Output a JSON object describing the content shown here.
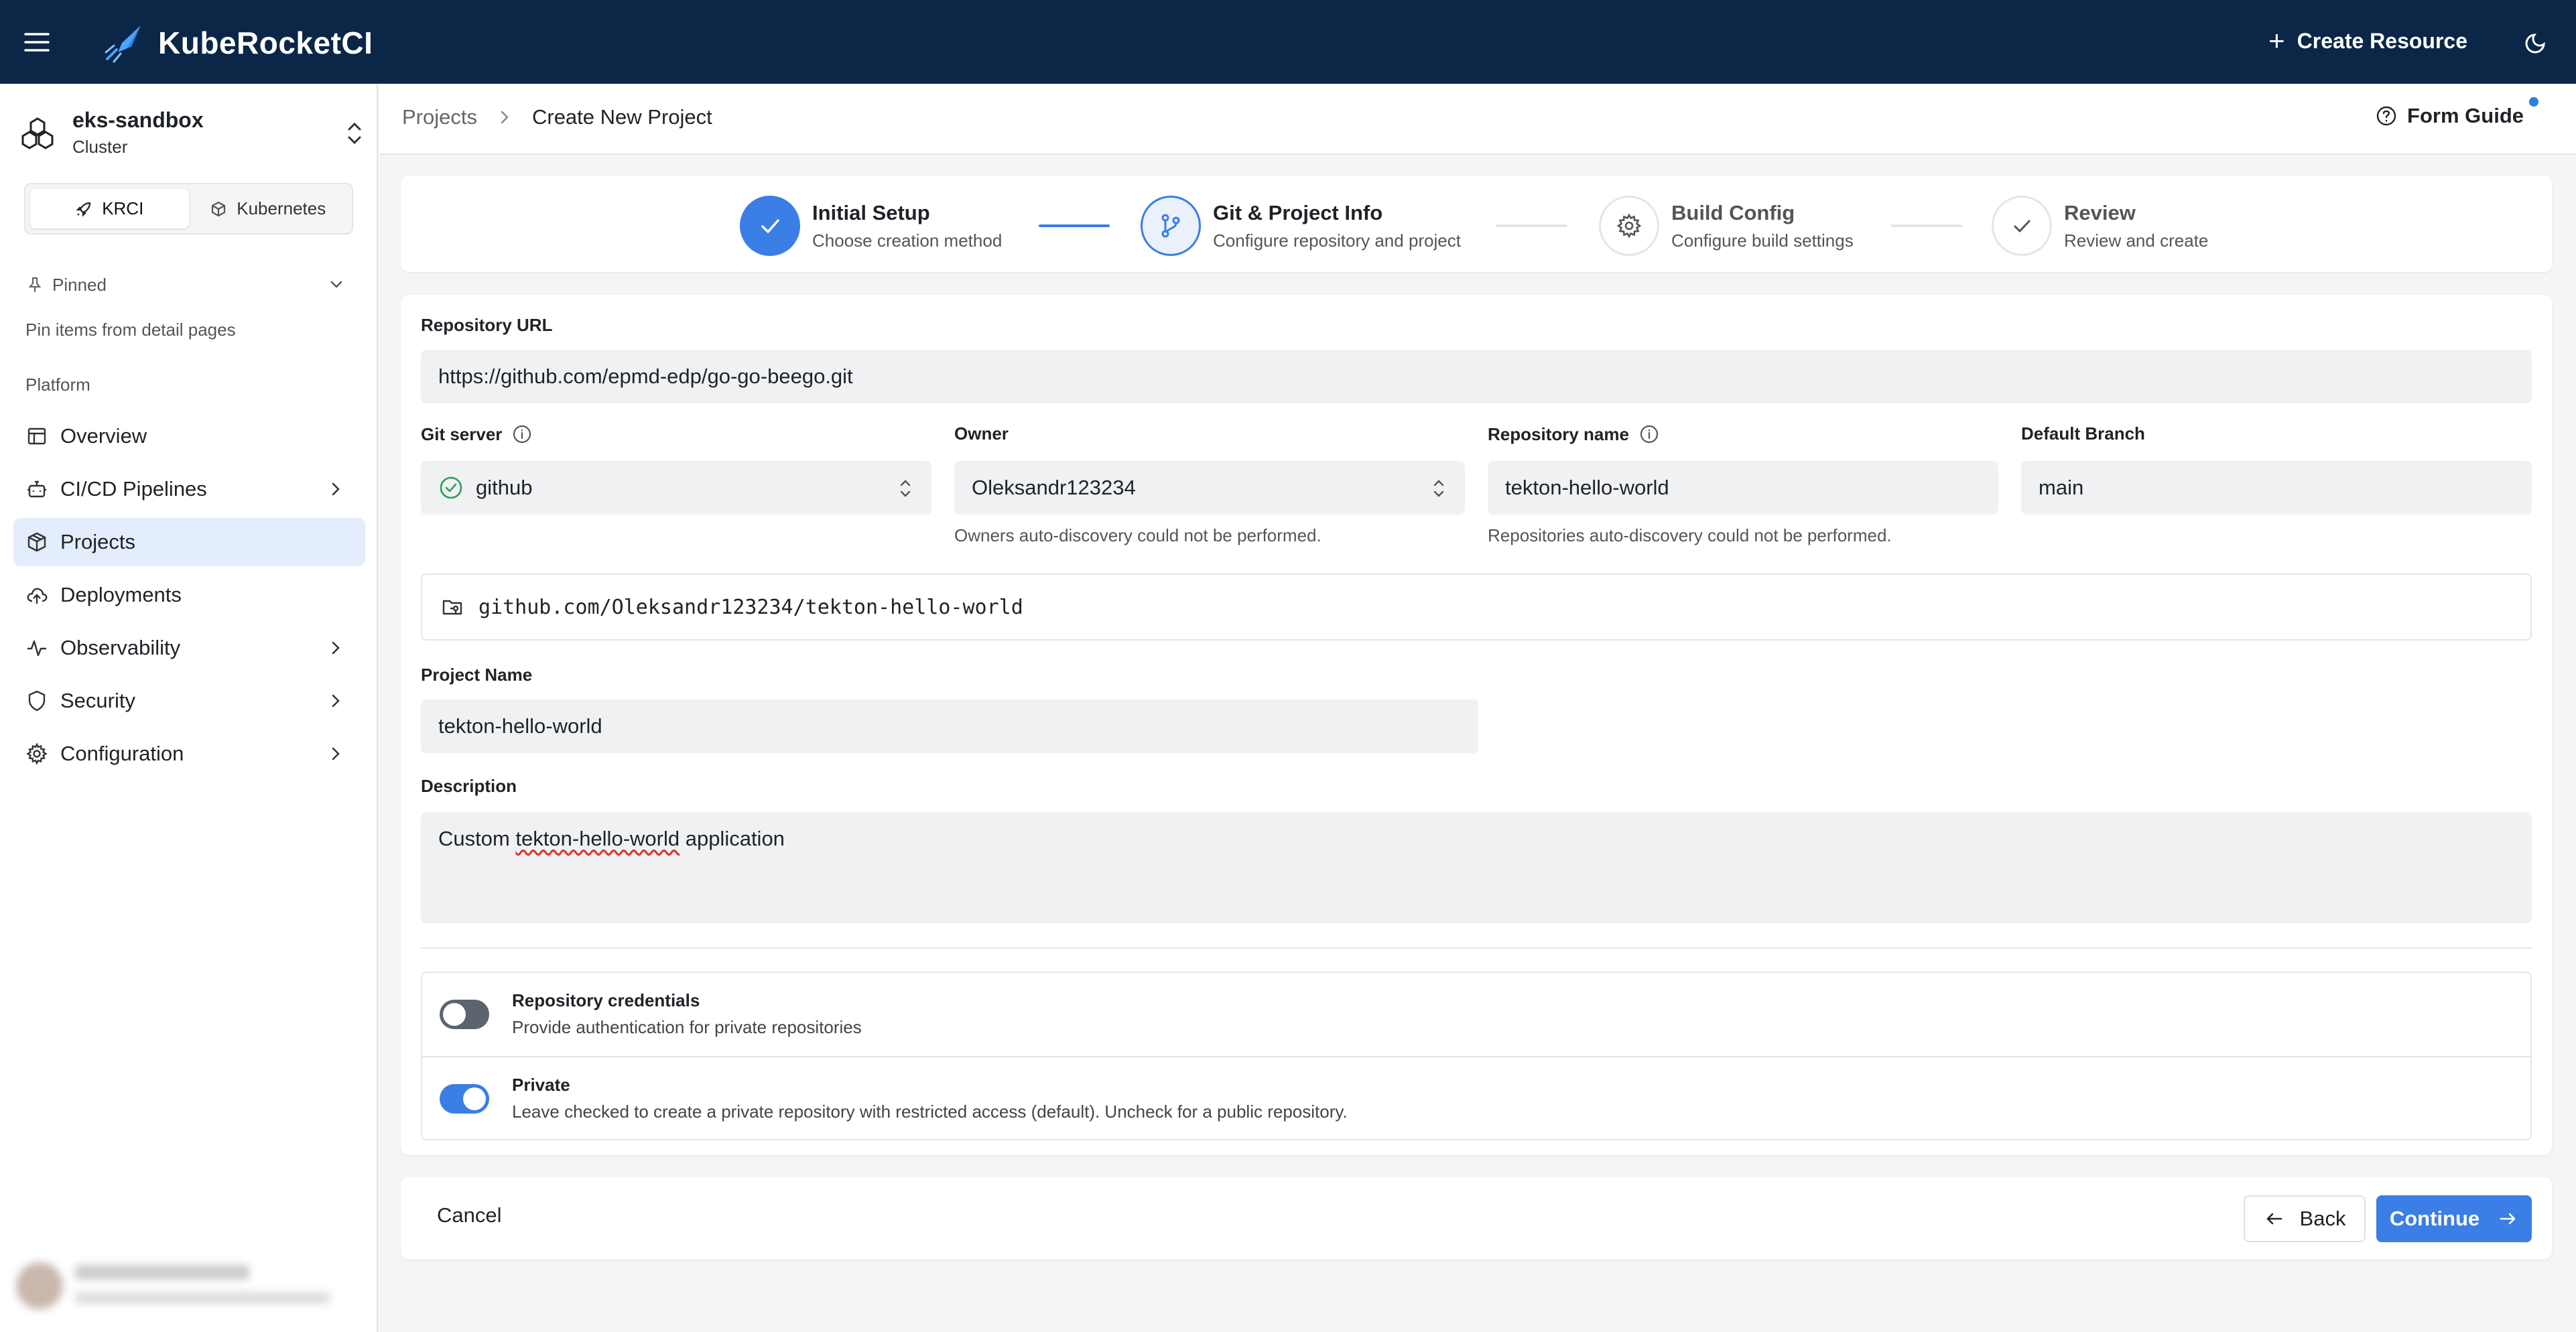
{
  "app": {
    "name": "KubeRocketCI",
    "create_resource_label": "Create Resource"
  },
  "cluster": {
    "name": "eks-sandbox",
    "type": "Cluster"
  },
  "view_switch": {
    "items": [
      {
        "label": "KRCI",
        "active": true
      },
      {
        "label": "Kubernetes",
        "active": false
      }
    ]
  },
  "pinned": {
    "label": "Pinned",
    "hint": "Pin items from detail pages"
  },
  "sidebar": {
    "section_label": "Platform",
    "items": [
      {
        "label": "Overview",
        "icon": "table-icon",
        "expandable": false,
        "active": false
      },
      {
        "label": "CI/CD Pipelines",
        "icon": "bot-icon",
        "expandable": true,
        "active": false
      },
      {
        "label": "Projects",
        "icon": "box-icon",
        "expandable": false,
        "active": true
      },
      {
        "label": "Deployments",
        "icon": "cloud-upload-icon",
        "expandable": false,
        "active": false
      },
      {
        "label": "Observability",
        "icon": "activity-icon",
        "expandable": true,
        "active": false
      },
      {
        "label": "Security",
        "icon": "shield-icon",
        "expandable": true,
        "active": false
      },
      {
        "label": "Configuration",
        "icon": "gear-icon",
        "expandable": true,
        "active": false
      }
    ]
  },
  "breadcrumb": {
    "parent": "Projects",
    "current": "Create New Project"
  },
  "form_guide_label": "Form Guide",
  "stepper": {
    "steps": [
      {
        "title": "Initial Setup",
        "subtitle": "Choose creation method",
        "state": "done"
      },
      {
        "title": "Git & Project Info",
        "subtitle": "Configure repository and project",
        "state": "current"
      },
      {
        "title": "Build Config",
        "subtitle": "Configure build settings",
        "state": "pending"
      },
      {
        "title": "Review",
        "subtitle": "Review and create",
        "state": "pending"
      }
    ]
  },
  "form": {
    "repository_url": {
      "label": "Repository URL",
      "value": "https://github.com/epmd-edp/go-go-beego.git"
    },
    "git_server": {
      "label": "Git server",
      "value": "github"
    },
    "owner": {
      "label": "Owner",
      "value": "Oleksandr123234",
      "hint": "Owners auto-discovery could not be performed."
    },
    "repository_name": {
      "label": "Repository name",
      "value": "tekton-hello-world",
      "hint": "Repositories auto-discovery could not be performed."
    },
    "default_branch": {
      "label": "Default Branch",
      "value": "main"
    },
    "repo_path": "github.com/Oleksandr123234/tekton-hello-world",
    "project_name": {
      "label": "Project Name",
      "value": "tekton-hello-world"
    },
    "description": {
      "label": "Description",
      "value_prefix": "Custom ",
      "value_misspelled": "tekton-hello-world",
      "value_suffix": " application"
    },
    "repository_credentials": {
      "title": "Repository credentials",
      "description": "Provide authentication for private repositories",
      "enabled": false
    },
    "private": {
      "title": "Private",
      "description": "Leave checked to create a private repository with restricted access (default). Uncheck for a public repository.",
      "enabled": true
    }
  },
  "actions": {
    "cancel": "Cancel",
    "back": "Back",
    "continue": "Continue"
  },
  "colors": {
    "topbar": "#0b2647",
    "accent": "#3a7ee6",
    "active_nav_bg": "#e4edfb"
  }
}
